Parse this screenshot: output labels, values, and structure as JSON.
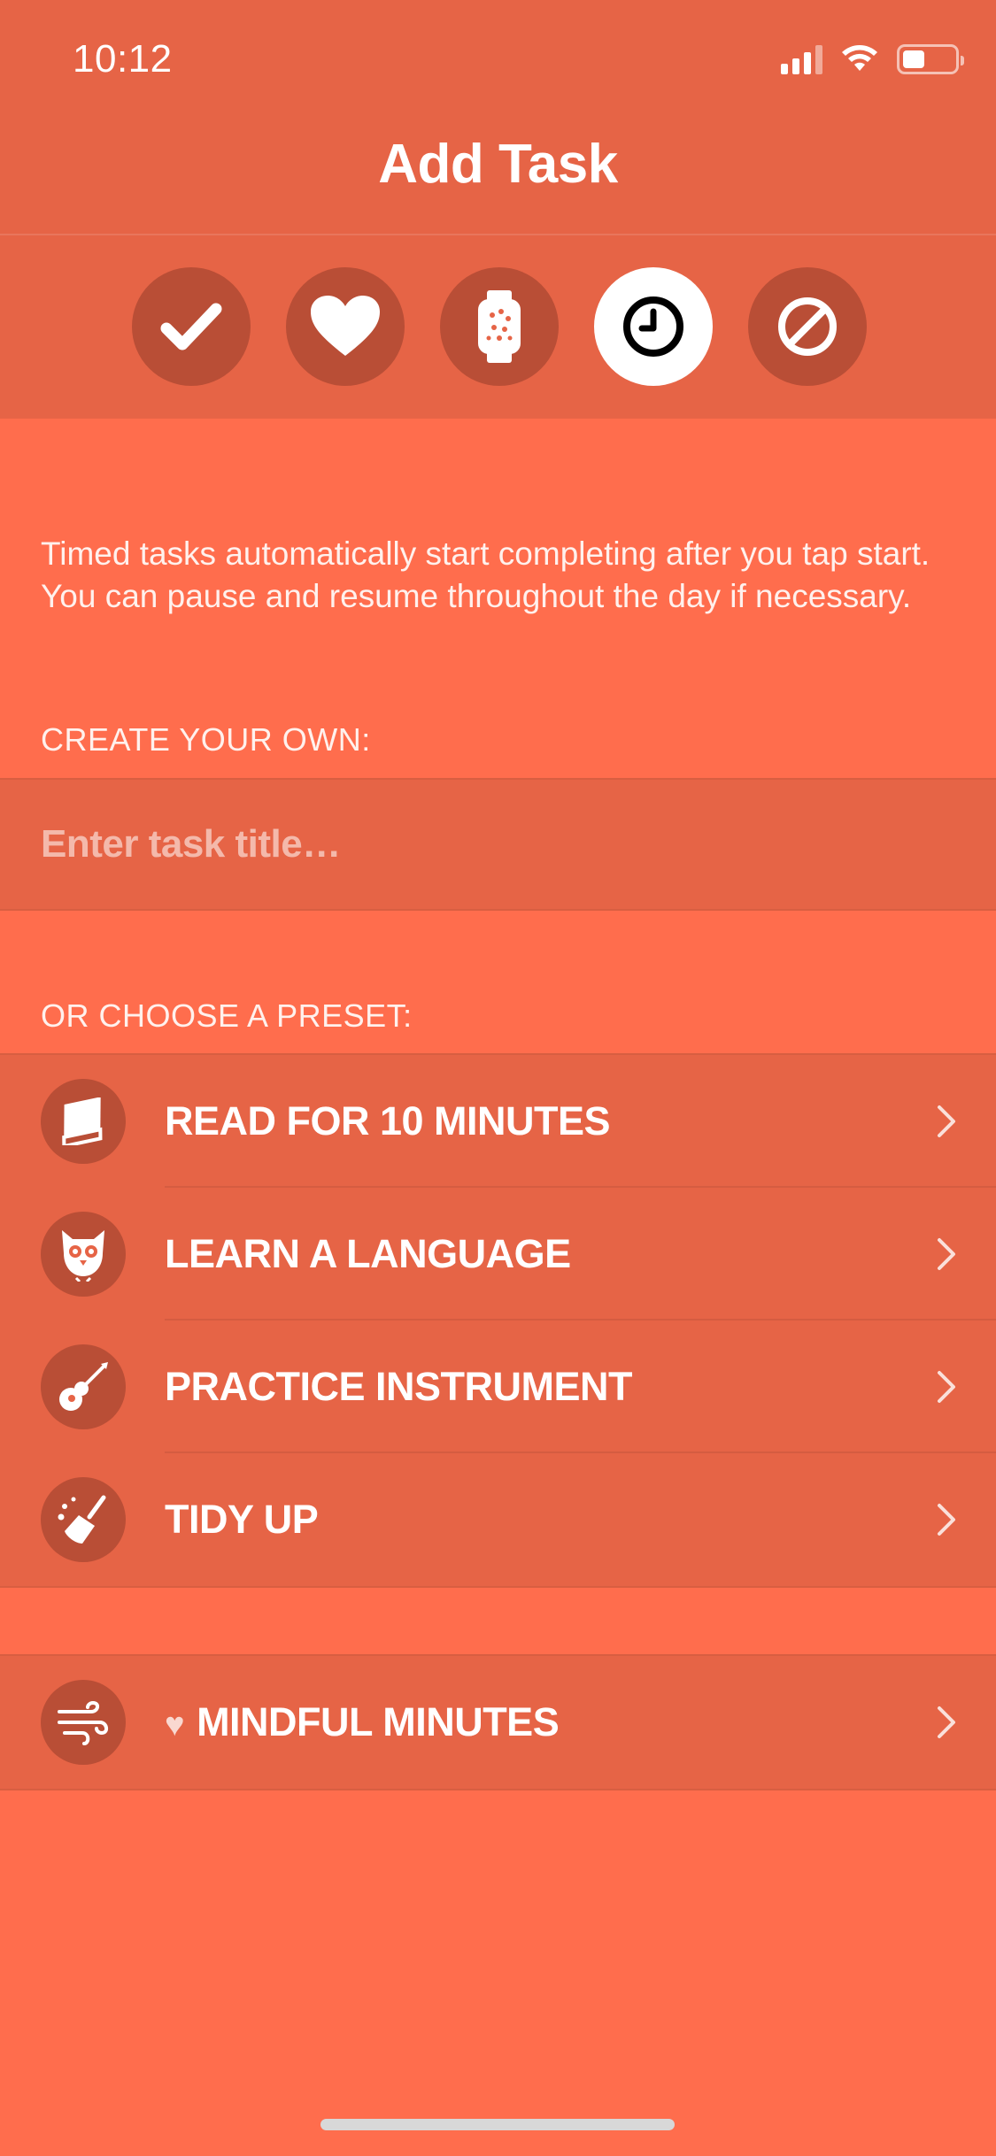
{
  "status_bar": {
    "time": "10:12",
    "signal_icon": "cellular-signal-icon",
    "wifi_icon": "wifi-icon",
    "battery_icon": "battery-icon"
  },
  "nav": {
    "title": "Add Task"
  },
  "task_types": [
    {
      "name": "checkmark-type",
      "icon": "checkmark-icon",
      "selected": false
    },
    {
      "name": "health-type",
      "icon": "heart-icon",
      "selected": false
    },
    {
      "name": "watch-type",
      "icon": "apple-watch-icon",
      "selected": false
    },
    {
      "name": "timed-type",
      "icon": "clock-icon",
      "selected": true
    },
    {
      "name": "habit-break-type",
      "icon": "prohibited-icon",
      "selected": false
    }
  ],
  "description": "Timed tasks automatically start completing after you tap start. You can pause and resume throughout the day if necessary.",
  "create_section": {
    "label": "CREATE YOUR OWN:",
    "input_value": "",
    "input_placeholder": "Enter task title…"
  },
  "preset_section": {
    "label": "OR CHOOSE A PRESET:",
    "items": [
      {
        "label": "READ FOR 10 MINUTES",
        "icon": "book-icon"
      },
      {
        "label": "LEARN A LANGUAGE",
        "icon": "owl-icon"
      },
      {
        "label": "PRACTICE INSTRUMENT",
        "icon": "guitar-icon"
      },
      {
        "label": "TIDY UP",
        "icon": "broom-icon"
      }
    ]
  },
  "health_section": {
    "items": [
      {
        "label": "MINDFUL MINUTES",
        "icon": "wind-icon",
        "badge_icon": "heart-icon"
      }
    ]
  },
  "colors": {
    "background": "#FF6D4D",
    "header": "#E66446",
    "icon_circle": "#B94E36",
    "selected_circle": "#FFFFFF"
  }
}
